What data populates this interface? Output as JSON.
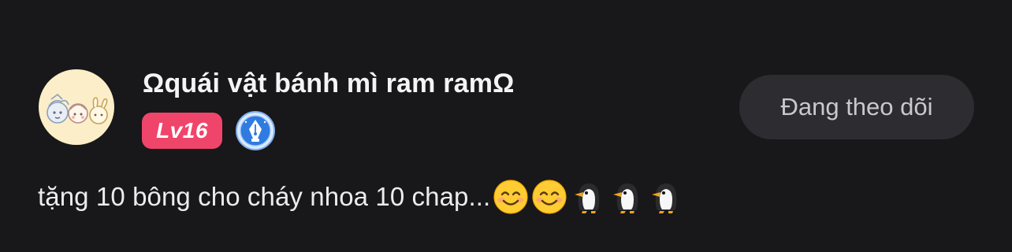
{
  "user": {
    "name": "Ωquái vật bánh mì ram ramΩ",
    "level": "Lv16",
    "level_color": "#f0456a",
    "badge_icon": "pen-nib-badge-icon",
    "badge_color": "#2f7be0"
  },
  "follow_button": {
    "label": "Đang theo dõi"
  },
  "comment": {
    "text": "tặng 10 bông cho cháy nhoa 10 chap...",
    "emojis": [
      "smiling-face-icon",
      "smiling-face-icon",
      "penguin-icon",
      "penguin-icon",
      "penguin-icon"
    ]
  },
  "colors": {
    "background": "#18171a",
    "button_bg": "#2d2c30",
    "button_text": "#c9c9cc",
    "avatar_bg": "#fbeec8"
  }
}
